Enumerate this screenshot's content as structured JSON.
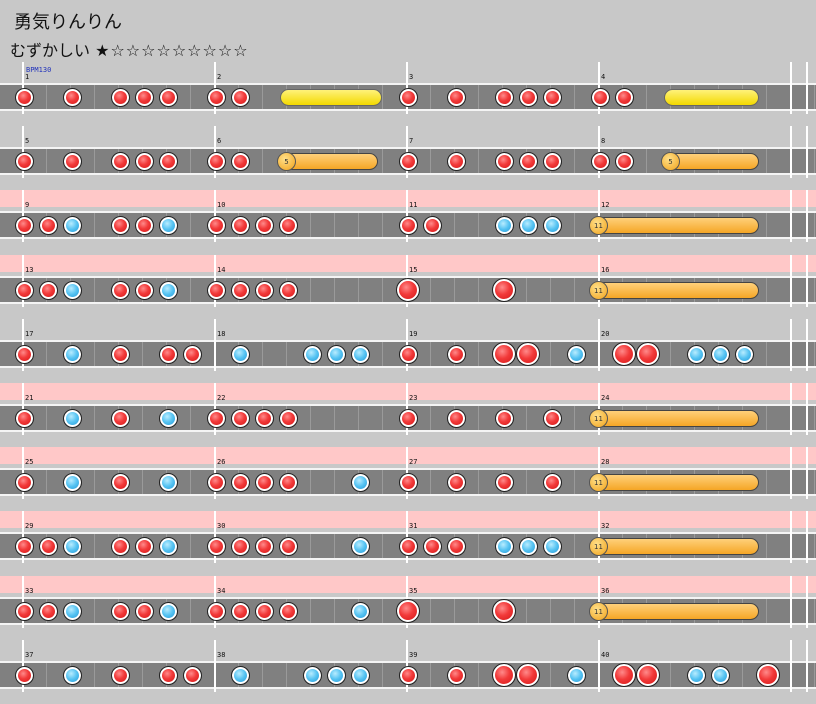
{
  "song": {
    "title": "勇気りんりん",
    "difficulty_label": "むずかしい",
    "stars": "★☆☆☆☆☆☆☆☆☆"
  },
  "bpm_label": "BPM130",
  "colors": {
    "don": "#e82a2a",
    "ka": "#3ab4f0",
    "drumroll": "#f5a626",
    "balloon": "#f3d900",
    "gogo": "#ffc8c8"
  },
  "rows": [
    {
      "gogo": false,
      "measures": [
        {
          "num": "1",
          "notes": [
            [
              "d",
              0
            ],
            [
              "d",
              2
            ],
            [
              "d",
              4
            ],
            [
              "d",
              5
            ],
            [
              "d",
              6
            ]
          ]
        },
        {
          "num": "2",
          "notes": [
            [
              "d",
              0
            ],
            [
              "d",
              1
            ]
          ],
          "rolls": [
            [
              "yellow",
              3,
              6.6
            ]
          ]
        },
        {
          "num": "3",
          "notes": [
            [
              "d",
              0
            ],
            [
              "d",
              2
            ],
            [
              "d",
              4
            ],
            [
              "d",
              5
            ],
            [
              "d",
              6
            ]
          ]
        },
        {
          "num": "4",
          "notes": [
            [
              "d",
              0
            ],
            [
              "d",
              1
            ]
          ],
          "rolls": [
            [
              "yellow",
              3,
              6.3
            ]
          ]
        }
      ]
    },
    {
      "gogo": false,
      "measures": [
        {
          "num": "5",
          "notes": [
            [
              "d",
              0
            ],
            [
              "d",
              2
            ],
            [
              "d",
              4
            ],
            [
              "d",
              5
            ],
            [
              "d",
              6
            ]
          ]
        },
        {
          "num": "6",
          "notes": [
            [
              "d",
              0
            ],
            [
              "d",
              1
            ]
          ],
          "rolls": [
            [
              "orange",
              3,
              6.4,
              "5"
            ]
          ]
        },
        {
          "num": "7",
          "notes": [
            [
              "d",
              0
            ],
            [
              "d",
              2
            ],
            [
              "d",
              4
            ],
            [
              "d",
              5
            ],
            [
              "d",
              6
            ]
          ]
        },
        {
          "num": "8",
          "notes": [
            [
              "d",
              0
            ],
            [
              "d",
              1
            ]
          ],
          "rolls": [
            [
              "orange",
              3,
              6.3,
              "5"
            ]
          ]
        }
      ]
    },
    {
      "gogo": true,
      "measures": [
        {
          "num": "9",
          "notes": [
            [
              "d",
              0
            ],
            [
              "d",
              1
            ],
            [
              "k",
              2
            ],
            [
              "d",
              4
            ],
            [
              "d",
              5
            ],
            [
              "k",
              6
            ]
          ]
        },
        {
          "num": "10",
          "notes": [
            [
              "d",
              0
            ],
            [
              "d",
              1
            ],
            [
              "d",
              2
            ],
            [
              "d",
              3
            ]
          ]
        },
        {
          "num": "11",
          "notes": [
            [
              "d",
              0
            ],
            [
              "d",
              1
            ],
            [
              "k",
              4
            ],
            [
              "k",
              5
            ],
            [
              "k",
              6
            ]
          ]
        },
        {
          "num": "12",
          "notes": [],
          "rolls": [
            [
              "orange",
              0,
              6.3,
              "11"
            ]
          ]
        }
      ]
    },
    {
      "gogo": true,
      "measures": [
        {
          "num": "13",
          "notes": [
            [
              "d",
              0
            ],
            [
              "d",
              1
            ],
            [
              "k",
              2
            ],
            [
              "d",
              4
            ],
            [
              "d",
              5
            ],
            [
              "k",
              6
            ]
          ]
        },
        {
          "num": "14",
          "notes": [
            [
              "d",
              0
            ],
            [
              "d",
              1
            ],
            [
              "d",
              2
            ],
            [
              "d",
              3
            ]
          ]
        },
        {
          "num": "15",
          "notes": [
            [
              "D",
              0
            ],
            [
              "D",
              4
            ]
          ]
        },
        {
          "num": "16",
          "notes": [],
          "rolls": [
            [
              "orange",
              0,
              6.3,
              "11"
            ]
          ]
        }
      ]
    },
    {
      "gogo": false,
      "measures": [
        {
          "num": "17",
          "notes": [
            [
              "d",
              0
            ],
            [
              "k",
              2
            ],
            [
              "d",
              4
            ],
            [
              "d",
              6
            ],
            [
              "d",
              7
            ]
          ]
        },
        {
          "num": "18",
          "notes": [
            [
              "k",
              1
            ],
            [
              "k",
              4
            ],
            [
              "k",
              5
            ],
            [
              "k",
              6
            ]
          ]
        },
        {
          "num": "19",
          "notes": [
            [
              "d",
              0
            ],
            [
              "d",
              2
            ],
            [
              "D",
              4
            ],
            [
              "D",
              5
            ],
            [
              "k",
              7
            ]
          ]
        },
        {
          "num": "20",
          "notes": [
            [
              "D",
              1
            ],
            [
              "D",
              2
            ],
            [
              "k",
              4
            ],
            [
              "k",
              5
            ],
            [
              "k",
              6
            ]
          ]
        }
      ]
    },
    {
      "gogo": true,
      "measures": [
        {
          "num": "21",
          "notes": [
            [
              "d",
              0
            ],
            [
              "k",
              2
            ],
            [
              "d",
              4
            ],
            [
              "k",
              6
            ]
          ]
        },
        {
          "num": "22",
          "notes": [
            [
              "d",
              0
            ],
            [
              "d",
              1
            ],
            [
              "d",
              2
            ],
            [
              "d",
              3
            ]
          ]
        },
        {
          "num": "23",
          "notes": [
            [
              "d",
              0
            ],
            [
              "d",
              2
            ],
            [
              "d",
              4
            ],
            [
              "d",
              6
            ]
          ]
        },
        {
          "num": "24",
          "notes": [],
          "rolls": [
            [
              "orange",
              0,
              6.3,
              "11"
            ]
          ]
        }
      ]
    },
    {
      "gogo": true,
      "measures": [
        {
          "num": "25",
          "notes": [
            [
              "d",
              0
            ],
            [
              "k",
              2
            ],
            [
              "d",
              4
            ],
            [
              "k",
              6
            ]
          ]
        },
        {
          "num": "26",
          "notes": [
            [
              "d",
              0
            ],
            [
              "d",
              1
            ],
            [
              "d",
              2
            ],
            [
              "d",
              3
            ],
            [
              "k",
              6
            ]
          ]
        },
        {
          "num": "27",
          "notes": [
            [
              "d",
              0
            ],
            [
              "d",
              2
            ],
            [
              "d",
              4
            ],
            [
              "d",
              6
            ]
          ]
        },
        {
          "num": "28",
          "notes": [],
          "rolls": [
            [
              "orange",
              0,
              6.3,
              "11"
            ]
          ]
        }
      ]
    },
    {
      "gogo": true,
      "measures": [
        {
          "num": "29",
          "notes": [
            [
              "d",
              0
            ],
            [
              "d",
              1
            ],
            [
              "k",
              2
            ],
            [
              "d",
              4
            ],
            [
              "d",
              5
            ],
            [
              "k",
              6
            ]
          ]
        },
        {
          "num": "30",
          "notes": [
            [
              "d",
              0
            ],
            [
              "d",
              1
            ],
            [
              "d",
              2
            ],
            [
              "d",
              3
            ],
            [
              "k",
              6
            ]
          ]
        },
        {
          "num": "31",
          "notes": [
            [
              "d",
              0
            ],
            [
              "d",
              1
            ],
            [
              "d",
              2
            ],
            [
              "k",
              4
            ],
            [
              "k",
              5
            ],
            [
              "k",
              6
            ]
          ]
        },
        {
          "num": "32",
          "notes": [],
          "rolls": [
            [
              "orange",
              0,
              6.3,
              "11"
            ]
          ]
        }
      ]
    },
    {
      "gogo": true,
      "measures": [
        {
          "num": "33",
          "notes": [
            [
              "d",
              0
            ],
            [
              "d",
              1
            ],
            [
              "k",
              2
            ],
            [
              "d",
              4
            ],
            [
              "d",
              5
            ],
            [
              "k",
              6
            ]
          ]
        },
        {
          "num": "34",
          "notes": [
            [
              "d",
              0
            ],
            [
              "d",
              1
            ],
            [
              "d",
              2
            ],
            [
              "d",
              3
            ],
            [
              "k",
              6
            ]
          ]
        },
        {
          "num": "35",
          "notes": [
            [
              "D",
              0
            ],
            [
              "D",
              4
            ]
          ]
        },
        {
          "num": "36",
          "notes": [],
          "rolls": [
            [
              "orange",
              0,
              6.3,
              "11"
            ]
          ]
        }
      ]
    },
    {
      "gogo": false,
      "measures": [
        {
          "num": "37",
          "notes": [
            [
              "d",
              0
            ],
            [
              "k",
              2
            ],
            [
              "d",
              4
            ],
            [
              "d",
              6
            ],
            [
              "d",
              7
            ]
          ]
        },
        {
          "num": "38",
          "notes": [
            [
              "k",
              1
            ],
            [
              "k",
              4
            ],
            [
              "k",
              5
            ],
            [
              "k",
              6
            ]
          ]
        },
        {
          "num": "39",
          "notes": [
            [
              "d",
              0
            ],
            [
              "d",
              2
            ],
            [
              "D",
              4
            ],
            [
              "D",
              5
            ],
            [
              "k",
              7
            ]
          ]
        },
        {
          "num": "40",
          "notes": [
            [
              "D",
              1
            ],
            [
              "D",
              2
            ],
            [
              "k",
              4
            ],
            [
              "k",
              5
            ],
            [
              "D",
              7
            ]
          ]
        }
      ]
    }
  ]
}
